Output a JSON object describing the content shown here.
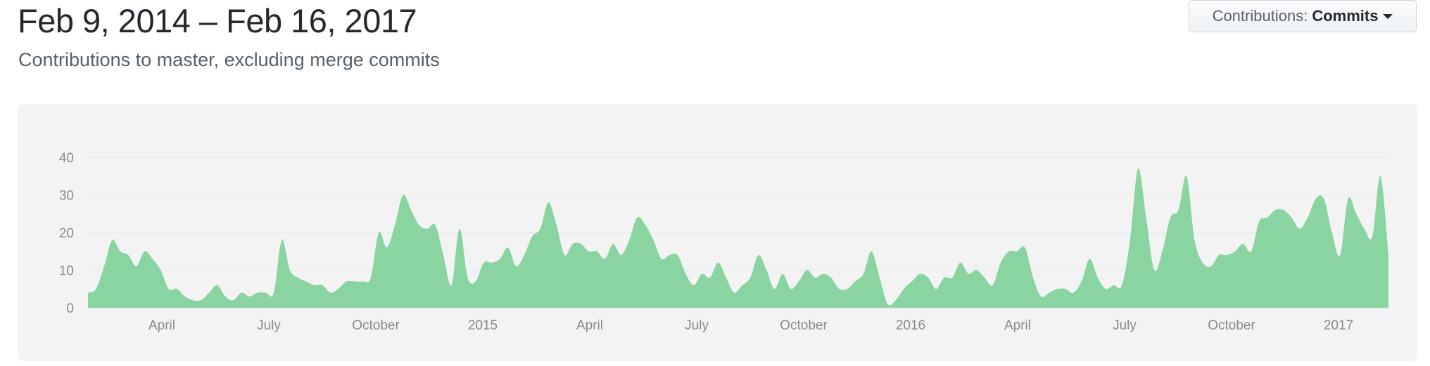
{
  "header": {
    "title": "Feb 9, 2014 – Feb 16, 2017",
    "subtitle": "Contributions to master, excluding merge commits"
  },
  "contributions_select": {
    "label": "Contributions:",
    "value": "Commits"
  },
  "chart_data": {
    "type": "area",
    "title": "",
    "xlabel": "",
    "ylabel": "",
    "ylim": [
      0,
      40
    ],
    "y_ticks": [
      "0",
      "10",
      "20",
      "30",
      "40"
    ],
    "x_ticks": [
      "April",
      "July",
      "October",
      "2015",
      "April",
      "July",
      "October",
      "2016",
      "April",
      "July",
      "October",
      "2017"
    ],
    "grid": true,
    "color": "#8ad4a2",
    "series": [
      {
        "values": [
          4,
          5,
          11,
          18,
          15,
          14,
          11,
          15,
          13,
          10,
          5,
          5,
          3,
          2,
          2,
          4,
          6,
          3,
          2,
          4,
          3,
          4,
          4,
          4,
          18,
          10,
          8,
          7,
          6,
          6,
          4,
          5,
          7,
          7,
          7,
          8,
          20,
          16,
          22,
          30,
          26,
          22,
          21,
          22,
          14,
          6,
          21,
          8,
          7,
          12,
          12,
          13,
          16,
          11,
          14,
          19,
          21,
          28,
          22,
          14,
          17,
          17,
          15,
          15,
          13,
          17,
          14,
          18,
          24,
          22,
          18,
          13,
          14,
          14,
          9,
          6,
          9,
          8,
          12,
          8,
          4,
          6,
          8,
          14,
          10,
          5,
          9,
          5,
          7,
          10,
          8,
          9,
          8,
          5,
          5,
          7,
          9,
          15,
          8,
          1,
          2,
          5,
          7,
          9,
          8,
          5,
          8,
          8,
          12,
          9,
          10,
          8,
          6,
          12,
          15,
          15,
          16,
          8,
          3,
          4,
          5,
          5,
          4,
          7,
          13,
          8,
          5,
          6,
          6,
          18,
          37,
          24,
          10,
          15,
          24,
          26,
          35,
          18,
          12,
          11,
          14,
          14,
          15,
          17,
          15,
          23,
          24,
          26,
          26,
          24,
          21,
          24,
          29,
          29,
          20,
          14,
          29,
          25,
          21,
          19,
          35,
          14
        ]
      }
    ]
  }
}
